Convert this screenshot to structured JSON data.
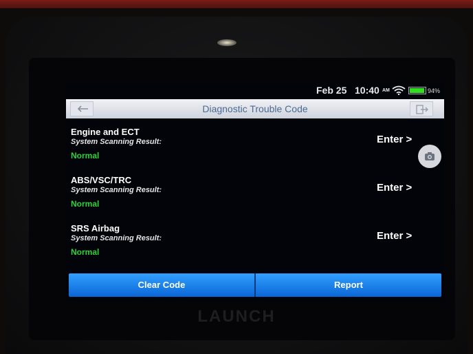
{
  "status_bar": {
    "date": "Feb 25",
    "time": "10:40",
    "ampm": "AM",
    "battery": "94%",
    "battery_level": 0.94,
    "battery_color": "#33dd22"
  },
  "header": {
    "title": "Diagnostic Trouble Code",
    "back_icon": "back-arrow-icon",
    "exit_icon": "exit-icon"
  },
  "systems": [
    {
      "name": "Engine and ECT",
      "subtitle": "System Scanning Result:",
      "status": "Normal",
      "action": "Enter >"
    },
    {
      "name": "ABS/VSC/TRC",
      "subtitle": "System Scanning Result:",
      "status": "Normal",
      "action": "Enter >"
    },
    {
      "name": "SRS Airbag",
      "subtitle": "System Scanning Result:",
      "status": "Normal",
      "action": "Enter >"
    }
  ],
  "floating": {
    "icon": "camera-icon"
  },
  "footer": {
    "clear_label": "Clear Code",
    "report_label": "Report"
  },
  "device": {
    "brand": "LAUNCH"
  },
  "colors": {
    "normal_status": "#2fd23a",
    "header_title": "#4a6a92",
    "footer_button": "#1a82ee"
  }
}
